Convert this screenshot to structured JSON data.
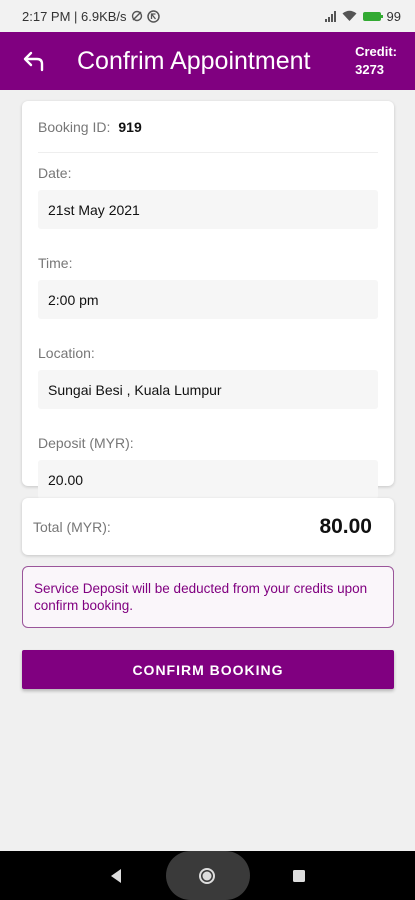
{
  "status_bar": {
    "time_info": "2:17 PM | 6.9KB/s",
    "battery_percent": "99"
  },
  "header": {
    "title": "Confrim Appointment",
    "credit_label": "Credit:",
    "credit_value": "3273"
  },
  "booking": {
    "id_label": "Booking ID:",
    "id_value": "919",
    "fields": [
      {
        "label": "Date:",
        "value": "21st May 2021"
      },
      {
        "label": "Time:",
        "value": "2:00 pm"
      },
      {
        "label": "Location:",
        "value": "Sungai Besi , Kuala Lumpur"
      },
      {
        "label": "Deposit (MYR):",
        "value": "20.00"
      }
    ]
  },
  "total": {
    "label": "Total (MYR):",
    "value": "80.00"
  },
  "notice": {
    "text": "Service Deposit will be deducted from your credits upon confirm booking."
  },
  "actions": {
    "confirm_label": "CONFIRM BOOKING"
  },
  "colors": {
    "primary": "#800080",
    "background": "#f0f0f0"
  },
  "icons": {
    "back": "back-arrow-icon",
    "nav_back": "nav-back-icon",
    "nav_home": "nav-home-icon",
    "nav_recents": "nav-recents-icon"
  }
}
